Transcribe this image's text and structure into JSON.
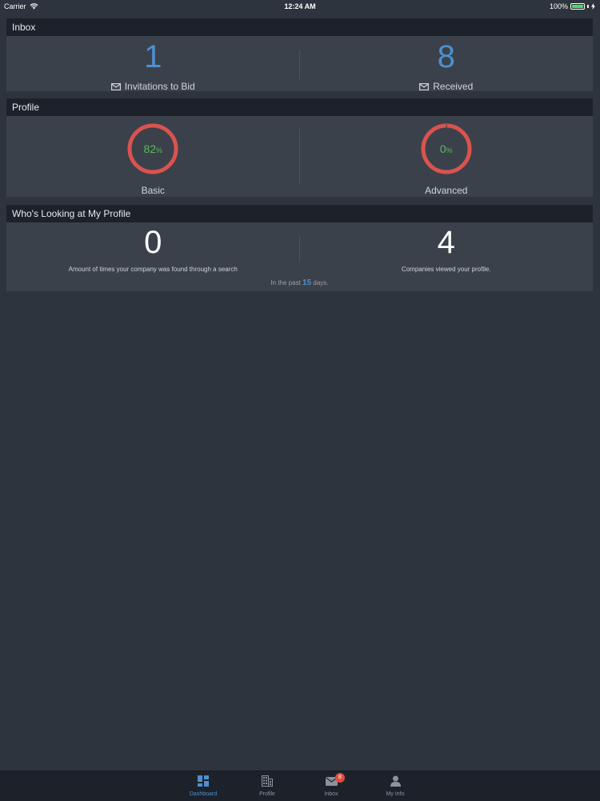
{
  "status_bar": {
    "carrier": "Carrier",
    "time": "12:24 AM",
    "battery": "100%"
  },
  "inbox": {
    "title": "Inbox",
    "invitations": {
      "count": "1",
      "label": "Invitations to Bid"
    },
    "received": {
      "count": "8",
      "label": "Received"
    }
  },
  "profile": {
    "title": "Profile",
    "basic": {
      "value": "82",
      "unit": "%",
      "label": "Basic",
      "percent": 82
    },
    "advanced": {
      "value": "0",
      "unit": "%",
      "label": "Advanced",
      "percent": 0
    }
  },
  "looking": {
    "title": "Who's Looking at My Profile",
    "search": {
      "count": "0",
      "caption": "Amount of times your company was found through a search"
    },
    "viewed": {
      "count": "4",
      "caption": "Companies viewed your profile."
    },
    "footer": {
      "prefix": "In the past",
      "days": "15",
      "suffix": "days."
    }
  },
  "tabbar": {
    "tabs": [
      {
        "label": "Dashboard",
        "icon": "dashboard-icon"
      },
      {
        "label": "Profile",
        "icon": "building-icon"
      },
      {
        "label": "Inbox",
        "icon": "mail-icon",
        "badge": "8"
      },
      {
        "label": "My Info",
        "icon": "person-icon"
      }
    ]
  },
  "colors": {
    "accent": "#4d90d1",
    "progress_good": "#5cb85c",
    "progress_bad": "#d9534f",
    "header_bg": "#1d222a",
    "card_bg": "#3b414a",
    "page_bg": "#2e343d"
  }
}
